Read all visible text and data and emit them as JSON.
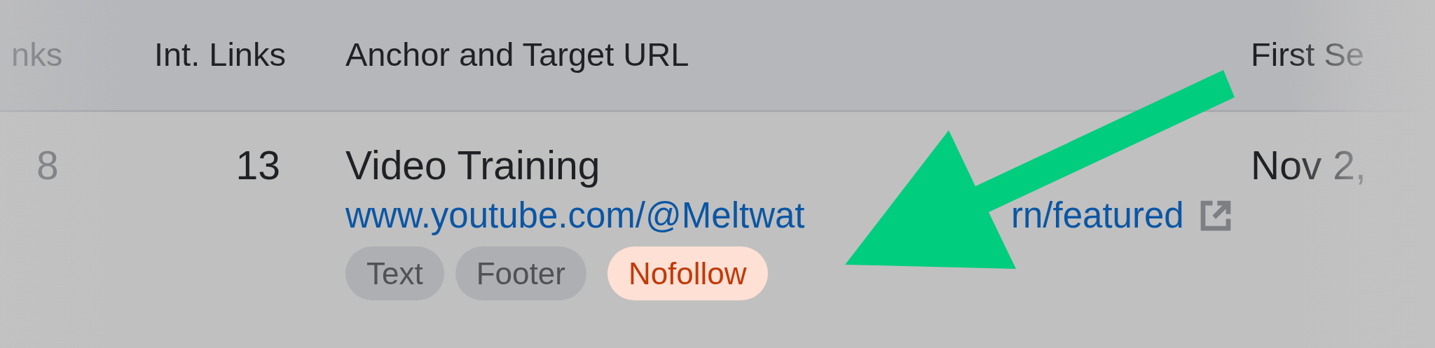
{
  "table": {
    "columns": [
      {
        "label": "nks",
        "faded": true
      },
      {
        "label": "Int. Links",
        "faded": false
      },
      {
        "label": "Anchor and Target URL",
        "faded": false
      },
      {
        "label": "First Se",
        "faded": false
      }
    ],
    "rows": [
      {
        "column_1": "8",
        "int_links": "13",
        "anchor": "Video Training",
        "target_url_parts": [
          "www.youtube.com/@Meltwat",
          "rn/featured"
        ],
        "tags": [
          {
            "label": "Text",
            "kind": "neutral"
          },
          {
            "label": "Footer",
            "kind": "neutral"
          },
          {
            "label": "Nofollow",
            "kind": "warning"
          }
        ],
        "first_seen": "Nov 2,"
      }
    ]
  }
}
